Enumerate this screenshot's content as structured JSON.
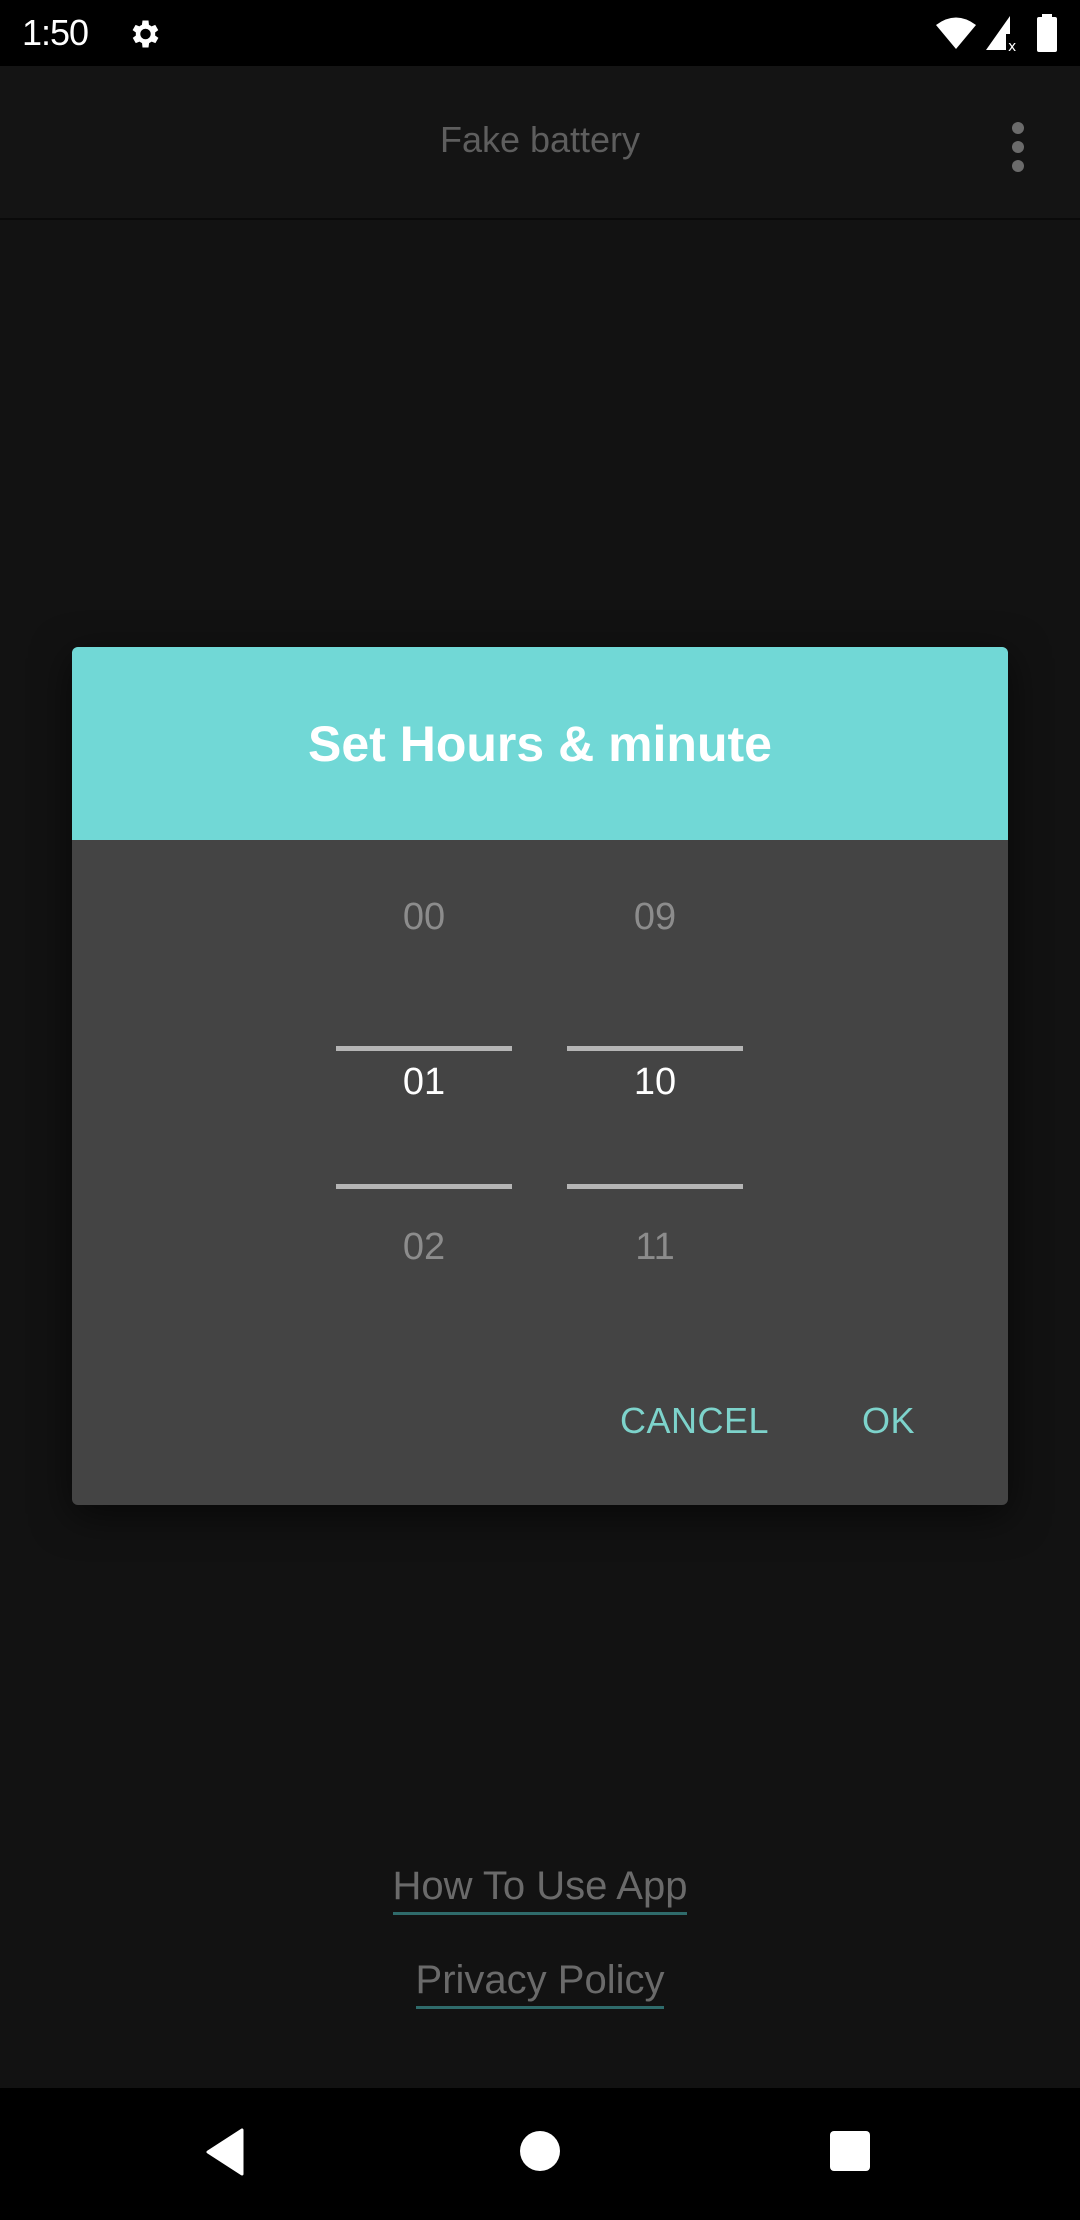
{
  "status_bar": {
    "time": "1:50",
    "icons": [
      "gear-icon",
      "wifi-icon",
      "signal-no-data-icon",
      "battery-icon"
    ]
  },
  "app_bar": {
    "title": "Fake battery",
    "overflow_icon": "more-vert-icon"
  },
  "dialog": {
    "title": "Set Hours & minute",
    "header_color": "#71d8d6",
    "hours": {
      "prev": "00",
      "selected": "01",
      "next": "02"
    },
    "minutes": {
      "prev": "09",
      "selected": "10",
      "next": "11"
    },
    "cancel_label": "CANCEL",
    "ok_label": "OK",
    "accent_color": "#7dd3cb"
  },
  "links": {
    "how_to_use": "How To Use App",
    "privacy_policy": "Privacy Policy"
  },
  "nav_bar": {
    "buttons": [
      "back-icon",
      "home-icon",
      "recents-icon"
    ]
  }
}
